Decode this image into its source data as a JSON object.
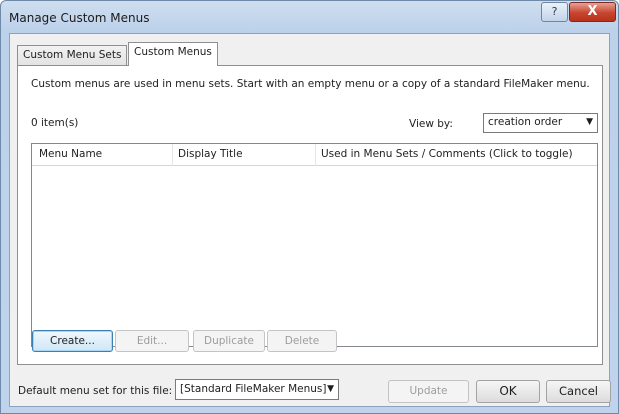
{
  "window": {
    "title": "Manage Custom Menus",
    "help_label": "?",
    "close_label": "X"
  },
  "tabs": [
    {
      "label": "Custom Menu Sets",
      "selected": false
    },
    {
      "label": "Custom Menus",
      "selected": true
    }
  ],
  "panel": {
    "description": "Custom menus are used in menu sets. Start with an empty menu or a copy of a standard FileMaker menu.",
    "item_count": "0 item(s)",
    "view_by_label": "View by:",
    "view_by_value": "creation order",
    "columns": [
      "Menu Name",
      "Display Title",
      "Used in Menu Sets / Comments (Click to toggle)"
    ],
    "rows": []
  },
  "buttons": {
    "create": "Create...",
    "edit": "Edit...",
    "duplicate": "Duplicate",
    "delete": "Delete"
  },
  "footer": {
    "default_label": "Default menu set for this file:",
    "default_value": "[Standard FileMaker Menus]",
    "update": "Update",
    "ok": "OK",
    "cancel": "Cancel"
  },
  "icons": {
    "dropdown": "chevron-down-icon",
    "help": "help-icon",
    "close": "close-icon"
  }
}
